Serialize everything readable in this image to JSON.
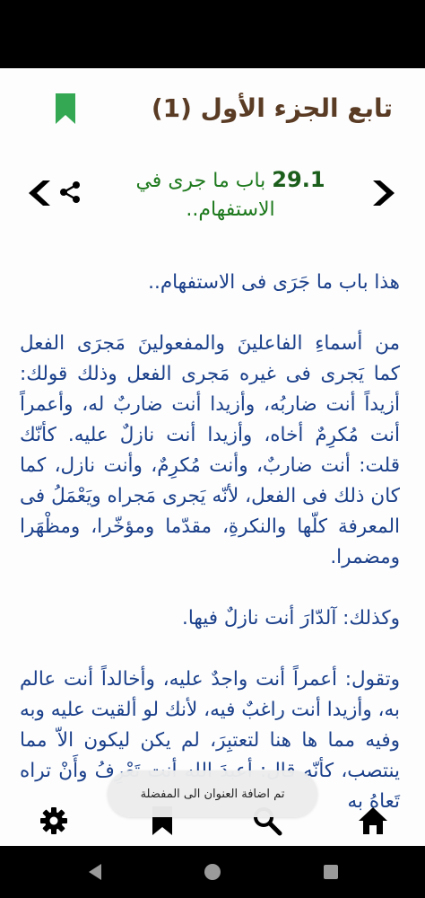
{
  "header": {
    "title": "تابع الجزء الأول (1)",
    "bookmark_icon": "bookmark-icon",
    "accent_color": "#34a853"
  },
  "chapter": {
    "number": "29.1",
    "title": "باب ما جرى في الاستفهام..",
    "next_icon": "chevron-right-icon",
    "prev_icon": "chevron-left-icon",
    "share_icon": "share-icon"
  },
  "content": {
    "paragraphs": [
      "هذا باب ما جَرَى فى الاستفهام..",
      "من أسماءِ الفاعلينَ والمفعولينَ مَجرَى الفعل كما يَجرى فى غيره مَجرى الفعل وذلك قولك: أزيداً أنت ضاربُه، وأزيدا أنت ضاربٌ له، وأعمراً أنت مُكرِمٌ أخاه، وأزيدا أنت نازلٌ عليه. كأنّك قلت: أنت ضاربٌ، وأنت مُكرِمٌ، وأنت نازل، كما كان ذلك فى الفعل، لأنّه يَجرى مَجراه ويَعْمَلُ فى المعرفة كلّها والنكرةِ، مقدّما ومؤخّرا، ومظْهَرا ومضمرا.",
      "وكذلك: آلدّارَ أنت نازلٌ فيها.",
      "وتقول: أعمراً أنت واجدٌ عليه، وأخالداً أنت عالم به، وأزيدا أنت راغبٌ فيه، لأنك لو ألقيت عليه وبه وفيه مما ها هنا لتعتبِرَ، لم يكن ليكون الاّ مما ينتصب، كأنّه قال: أعبدَ الله أنت تَعْرِفُ وأَنْ تراه تَعاهُ به"
    ]
  },
  "toast": {
    "text": "تم اضافة العنوان الى المفضلة"
  },
  "bottom_nav": {
    "items": [
      "gear-icon",
      "bookmark-icon",
      "search-icon",
      "home-icon"
    ]
  },
  "colors": {
    "title": "#5a3b24",
    "chapter": "#1e7a1e",
    "body_text": "#1a3f8a"
  }
}
